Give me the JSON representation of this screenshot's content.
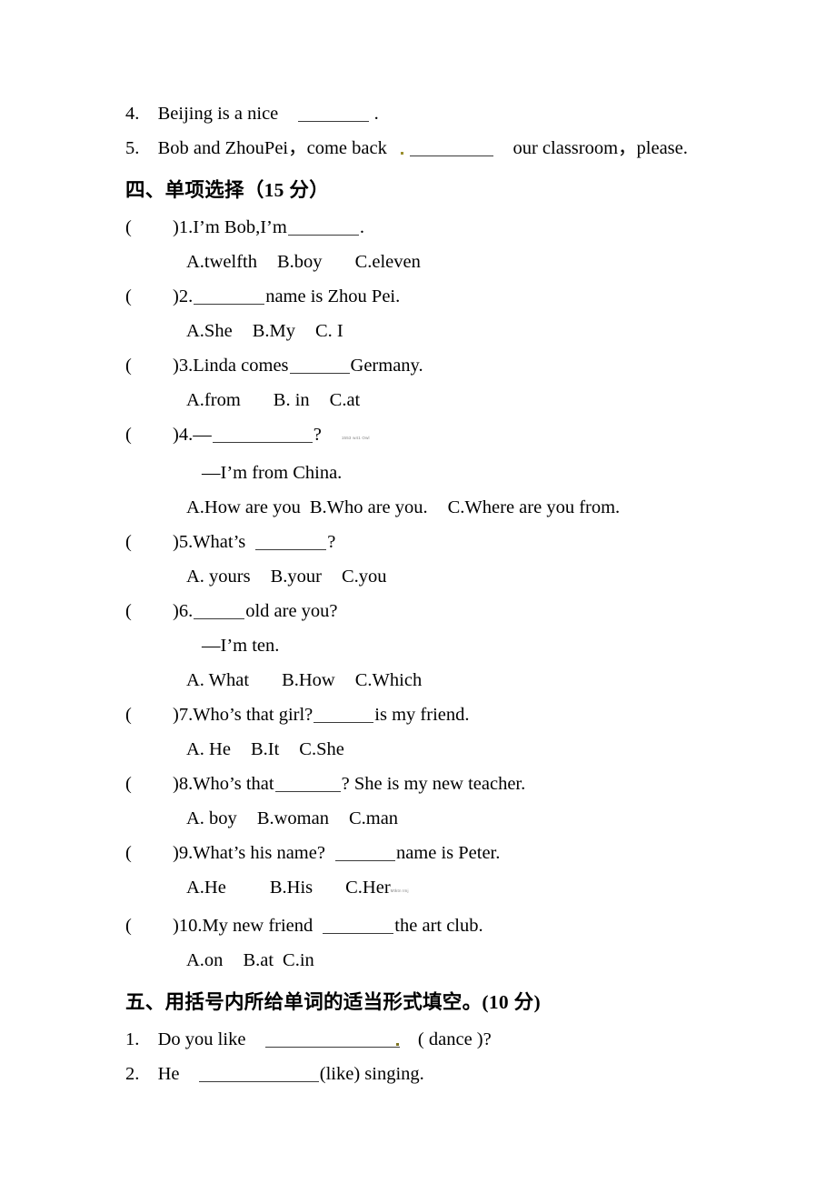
{
  "document": {
    "type": "scanned-exam-paper",
    "language": "en-zh"
  },
  "fill_in_section_tail": {
    "items": [
      {
        "number": "4.",
        "before": "Beijing is a nice",
        "after": "."
      },
      {
        "number": "5.",
        "before": "Bob and ZhouPei，come back",
        "after": "our classroom，please."
      }
    ]
  },
  "section_four": {
    "heading_cn": "四、单项选择",
    "heading_score": "（15 分）",
    "questions": [
      {
        "paren": "(",
        "paren_close": ")",
        "number": "1.",
        "stem_before": "I’m Bob,I’m",
        "stem_after": ".",
        "options": [
          "A.twelfth",
          "B.boy",
          "C.eleven"
        ]
      },
      {
        "paren": "(",
        "paren_close": ")",
        "number": "2.",
        "stem_before": "",
        "stem_after": "name is Zhou Pei.",
        "options": [
          "A.She",
          "B.My",
          "C. I"
        ]
      },
      {
        "paren": "(",
        "paren_close": ")",
        "number": "3.",
        "stem_before": "Linda comes",
        "stem_after": "Germany.",
        "options": [
          "A.from",
          "B. in",
          "C.at"
        ]
      },
      {
        "paren": "(",
        "paren_close": ")",
        "number": "4.",
        "stem_before": "—",
        "stem_after": "?",
        "artifact": "1553 w41 Owl",
        "reply": "—I’m from China.",
        "options": [
          "A.How are you",
          "B.Who are you.",
          "C.Where are you from."
        ]
      },
      {
        "paren": "(",
        "paren_close": ")",
        "number": "5.",
        "stem_before": "What’s",
        "stem_after": "?",
        "options": [
          "A.  yours",
          "B.your",
          "C.you"
        ]
      },
      {
        "paren": "(",
        "paren_close": ")",
        "number": "6.",
        "stem_before": "",
        "stem_after": "old are you?",
        "reply": "—I’m ten.",
        "options": [
          "A.  What",
          "B.How",
          "C.Which"
        ]
      },
      {
        "paren": "(",
        "paren_close": ")",
        "number": "7.",
        "stem_before": "Who’s that girl?",
        "stem_after": "is my friend.",
        "options": [
          "A.  He",
          "B.It",
          "C.She"
        ]
      },
      {
        "paren": "(",
        "paren_close": ")",
        "number": "8.",
        "stem_before": "Who’s that",
        "stem_after": "? She is my new teacher.",
        "options": [
          "A.   boy",
          "B.woman",
          "C.man"
        ]
      },
      {
        "paren": "(",
        "paren_close": ")",
        "number": "9.",
        "stem_before": "What’s his name?",
        "stem_after": "name is Peter.",
        "options": [
          "A.He",
          "B.His",
          "C.Her"
        ],
        "option_artifact": "Mtktn Imj"
      },
      {
        "paren": "(",
        "paren_close": ")",
        "number": "10.",
        "stem_before": "My new friend",
        "stem_after": "the art club.",
        "options": [
          "A.on",
          "B.at",
          "C.in"
        ]
      }
    ]
  },
  "section_five": {
    "heading_cn": "五、用括号内所给单词的适当形式填空。",
    "heading_score": "(10 分)",
    "items": [
      {
        "number": "1.",
        "before": "Do you like",
        "after": "( dance )?"
      },
      {
        "number": "2.",
        "before": "He",
        "after": "(like) singing."
      }
    ]
  }
}
